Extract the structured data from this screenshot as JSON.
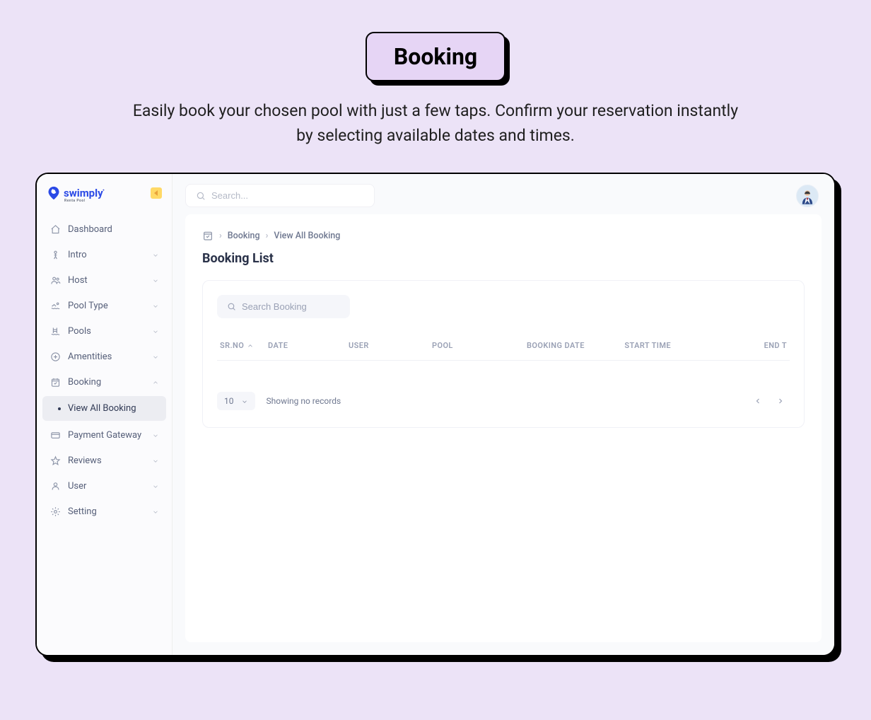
{
  "hero": {
    "badge": "Booking",
    "description": "Easily book your chosen pool with just a few taps. Confirm your reservation instantly by selecting available dates and times."
  },
  "app": {
    "logo": {
      "name": "swimply",
      "tagline": "Renta Pool"
    },
    "search_placeholder": "Search...",
    "sidebar": {
      "items": [
        {
          "label": "Dashboard",
          "icon": "home",
          "expandable": false
        },
        {
          "label": "Intro",
          "icon": "person",
          "expandable": true
        },
        {
          "label": "Host",
          "icon": "users",
          "expandable": true
        },
        {
          "label": "Pool Type",
          "icon": "swim",
          "expandable": true
        },
        {
          "label": "Pools",
          "icon": "pool-ladder",
          "expandable": true
        },
        {
          "label": "Amentities",
          "icon": "plus-circle",
          "expandable": true
        },
        {
          "label": "Booking",
          "icon": "calendar-check",
          "expandable": true,
          "expanded": true
        },
        {
          "label": "Payment Gateway",
          "icon": "credit-card",
          "expandable": true
        },
        {
          "label": "Reviews",
          "icon": "star",
          "expandable": true
        },
        {
          "label": "User",
          "icon": "user",
          "expandable": true
        },
        {
          "label": "Setting",
          "icon": "gear",
          "expandable": true
        }
      ],
      "booking_sub": {
        "label": "View All Booking"
      }
    },
    "breadcrumb": {
      "a": "Booking",
      "b": "View All Booking"
    },
    "page_title": "Booking List",
    "card": {
      "search_placeholder": "Search Booking",
      "columns": {
        "sr": "SR.NO",
        "date": "DATE",
        "user": "USER",
        "pool": "POOL",
        "booking_date": "BOOKING DATE",
        "start": "START TIME",
        "end": "END T"
      },
      "page_size": "10",
      "empty_text": "Showing no records"
    }
  }
}
